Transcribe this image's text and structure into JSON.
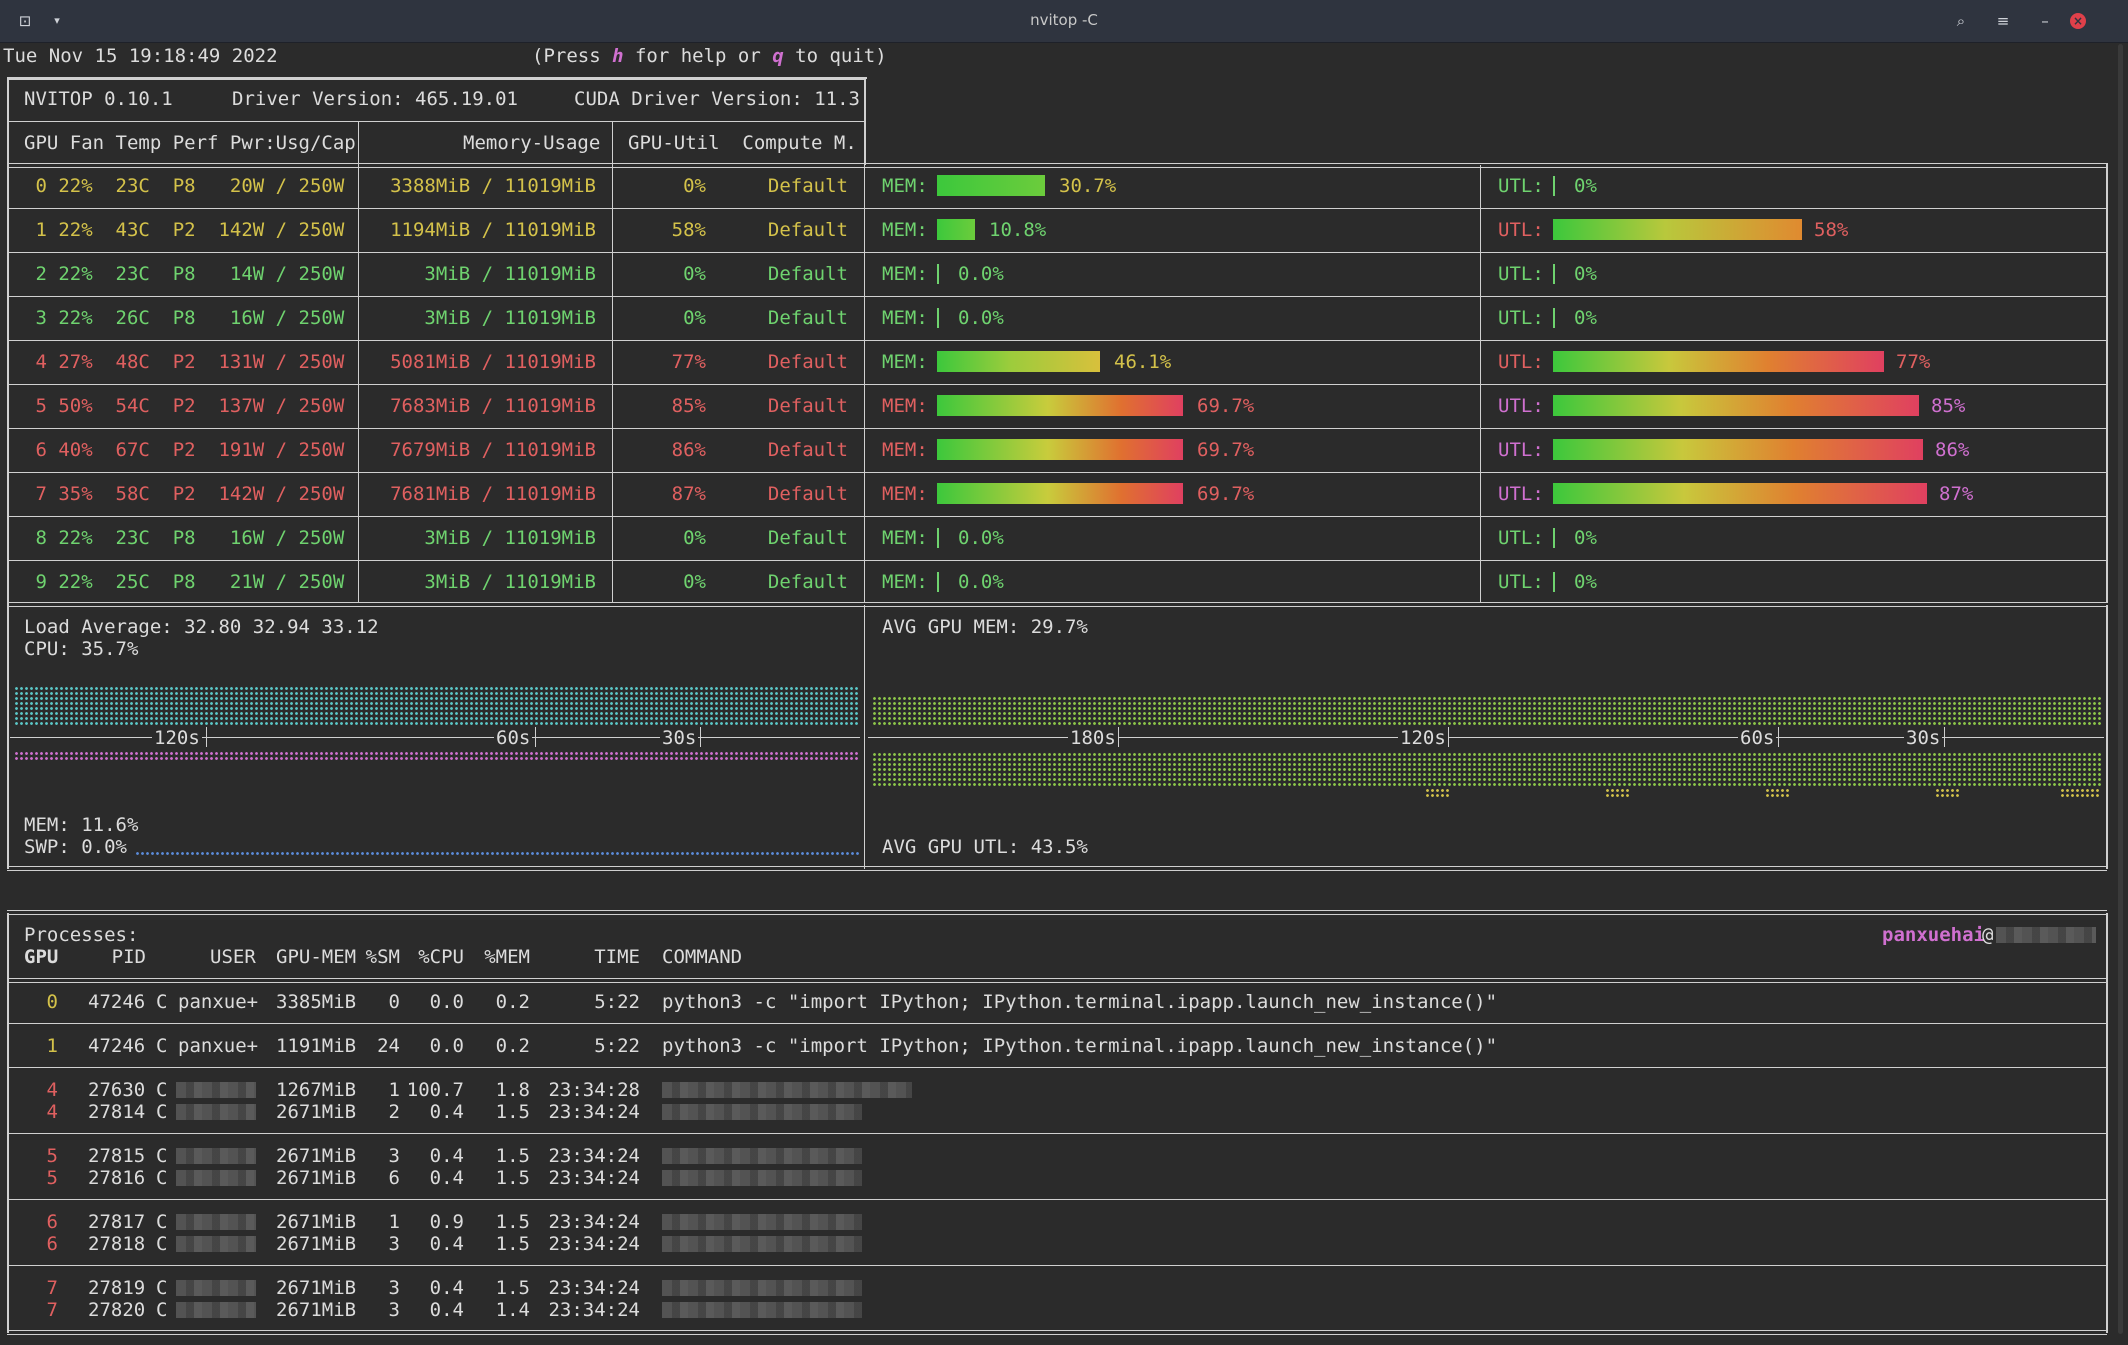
{
  "window": {
    "title": "nvitop -C"
  },
  "header": {
    "datetime": "Tue Nov 15 19:18:49 2022",
    "help": "(Press h for help or q to quit)"
  },
  "versions": {
    "nvitop": "NVITOP 0.10.1",
    "driver": "Driver Version: 465.19.01",
    "cuda": "CUDA Driver Version: 11.3"
  },
  "columns": {
    "left": "GPU Fan Temp Perf Pwr:Usg/Cap",
    "mem": "Memory-Usage",
    "util": "GPU-Util  Compute M."
  },
  "gpus": [
    {
      "info": " 0 22%  23C  P8   20W / 250W",
      "mem": "3388MiB / 11019MiB",
      "util": "0%",
      "mode": "Default",
      "mem_pct": 30.7,
      "mem_label": "30.7%",
      "utl_pct": 0,
      "utl_label": "0%",
      "color": "y"
    },
    {
      "info": " 1 22%  43C  P2  142W / 250W",
      "mem": "1194MiB / 11019MiB",
      "util": "58%",
      "mode": "Default",
      "mem_pct": 10.8,
      "mem_label": "10.8%",
      "utl_pct": 58,
      "utl_label": "58%",
      "color": "y"
    },
    {
      "info": " 2 22%  23C  P8   14W / 250W",
      "mem": "3MiB / 11019MiB",
      "util": "0%",
      "mode": "Default",
      "mem_pct": 0,
      "mem_label": "0.0%",
      "utl_pct": 0,
      "utl_label": "0%",
      "color": "g"
    },
    {
      "info": " 3 22%  26C  P8   16W / 250W",
      "mem": "3MiB / 11019MiB",
      "util": "0%",
      "mode": "Default",
      "mem_pct": 0,
      "mem_label": "0.0%",
      "utl_pct": 0,
      "utl_label": "0%",
      "color": "g"
    },
    {
      "info": " 4 27%  48C  P2  131W / 250W",
      "mem": "5081MiB / 11019MiB",
      "util": "77%",
      "mode": "Default",
      "mem_pct": 46.1,
      "mem_label": "46.1%",
      "utl_pct": 77,
      "utl_label": "77%",
      "color": "r"
    },
    {
      "info": " 5 50%  54C  P2  137W / 250W",
      "mem": "7683MiB / 11019MiB",
      "util": "85%",
      "mode": "Default",
      "mem_pct": 69.7,
      "mem_label": "69.7%",
      "utl_pct": 85,
      "utl_label": "85%",
      "color": "r"
    },
    {
      "info": " 6 40%  67C  P2  191W / 250W",
      "mem": "7679MiB / 11019MiB",
      "util": "86%",
      "mode": "Default",
      "mem_pct": 69.7,
      "mem_label": "69.7%",
      "utl_pct": 86,
      "utl_label": "86%",
      "color": "r"
    },
    {
      "info": " 7 35%  58C  P2  142W / 250W",
      "mem": "7681MiB / 11019MiB",
      "util": "87%",
      "mode": "Default",
      "mem_pct": 69.7,
      "mem_label": "69.7%",
      "utl_pct": 87,
      "utl_label": "87%",
      "color": "r"
    },
    {
      "info": " 8 22%  23C  P8   16W / 250W",
      "mem": "3MiB / 11019MiB",
      "util": "0%",
      "mode": "Default",
      "mem_pct": 0,
      "mem_label": "0.0%",
      "utl_pct": 0,
      "utl_label": "0%",
      "color": "g"
    },
    {
      "info": " 9 22%  25C  P8   21W / 250W",
      "mem": "3MiB / 11019MiB",
      "util": "0%",
      "mode": "Default",
      "mem_pct": 0,
      "mem_label": "0.0%",
      "utl_pct": 0,
      "utl_label": "0%",
      "color": "g"
    }
  ],
  "labels": {
    "mem": "MEM:",
    "utl": "UTL:"
  },
  "host": {
    "load": "Load Average: 32.80 32.94 33.12",
    "cpu": "CPU: 35.7%",
    "mem": "MEM: 11.6%",
    "swp": "SWP: 0.0%",
    "ticks_left": [
      "120s",
      "60s",
      "30s"
    ],
    "ticks_right": [
      "180s",
      "120s",
      "60s",
      "30s"
    ],
    "avg_mem": "AVG GPU MEM: 29.7%",
    "avg_utl": "AVG GPU UTL: 43.5%"
  },
  "processes": {
    "title": "Processes:",
    "user": "panxuehai",
    "at": "@",
    "header": [
      "GPU",
      "PID",
      "USER",
      "GPU-MEM",
      "%SM",
      "%CPU",
      "%MEM",
      "TIME",
      "COMMAND"
    ],
    "rows": [
      {
        "gpu": "0",
        "pid": "47246",
        "type": "C",
        "user": "panxue+",
        "mem": "3385MiB",
        "sm": "0",
        "cpu": "0.0",
        "pmem": "0.2",
        "time": "5:22",
        "cmd": "python3 -c \"import IPython; IPython.terminal.ipapp.launch_new_instance()\"",
        "gcolor": "y"
      },
      {
        "gpu": "1",
        "pid": "47246",
        "type": "C",
        "user": "panxue+",
        "mem": "1191MiB",
        "sm": "24",
        "cpu": "0.0",
        "pmem": "0.2",
        "time": "5:22",
        "cmd": "python3 -c \"import IPython; IPython.terminal.ipapp.launch_new_instance()\"",
        "gcolor": "y"
      },
      {
        "gpu": "4",
        "pid": "27630",
        "type": "C",
        "user": "",
        "mem": "1267MiB",
        "sm": "1",
        "cpu": "100.7",
        "pmem": "1.8",
        "time": "23:34:28",
        "cmd": "",
        "gcolor": "r"
      },
      {
        "gpu": "4",
        "pid": "27814",
        "type": "C",
        "user": "",
        "mem": "2671MiB",
        "sm": "2",
        "cpu": "0.4",
        "pmem": "1.5",
        "time": "23:34:24",
        "cmd": "",
        "gcolor": "r"
      },
      {
        "gpu": "5",
        "pid": "27815",
        "type": "C",
        "user": "",
        "mem": "2671MiB",
        "sm": "3",
        "cpu": "0.4",
        "pmem": "1.5",
        "time": "23:34:24",
        "cmd": "",
        "gcolor": "r"
      },
      {
        "gpu": "5",
        "pid": "27816",
        "type": "C",
        "user": "",
        "mem": "2671MiB",
        "sm": "6",
        "cpu": "0.4",
        "pmem": "1.5",
        "time": "23:34:24",
        "cmd": "",
        "gcolor": "r"
      },
      {
        "gpu": "6",
        "pid": "27817",
        "type": "C",
        "user": "",
        "mem": "2671MiB",
        "sm": "1",
        "cpu": "0.9",
        "pmem": "1.5",
        "time": "23:34:24",
        "cmd": "",
        "gcolor": "r"
      },
      {
        "gpu": "6",
        "pid": "27818",
        "type": "C",
        "user": "",
        "mem": "2671MiB",
        "sm": "3",
        "cpu": "0.4",
        "pmem": "1.5",
        "time": "23:34:24",
        "cmd": "",
        "gcolor": "r"
      },
      {
        "gpu": "7",
        "pid": "27819",
        "type": "C",
        "user": "",
        "mem": "2671MiB",
        "sm": "3",
        "cpu": "0.4",
        "pmem": "1.5",
        "time": "23:34:24",
        "cmd": "",
        "gcolor": "r"
      },
      {
        "gpu": "7",
        "pid": "27820",
        "type": "C",
        "user": "",
        "mem": "2671MiB",
        "sm": "3",
        "cpu": "0.4",
        "pmem": "1.4",
        "time": "23:34:24",
        "cmd": "",
        "gcolor": "r"
      }
    ]
  },
  "colors": {
    "green": "#6fd36f",
    "yellow": "#d4c24a",
    "red": "#e06060",
    "magenta": "#d070d0",
    "cyan": "#5bc8c8"
  }
}
